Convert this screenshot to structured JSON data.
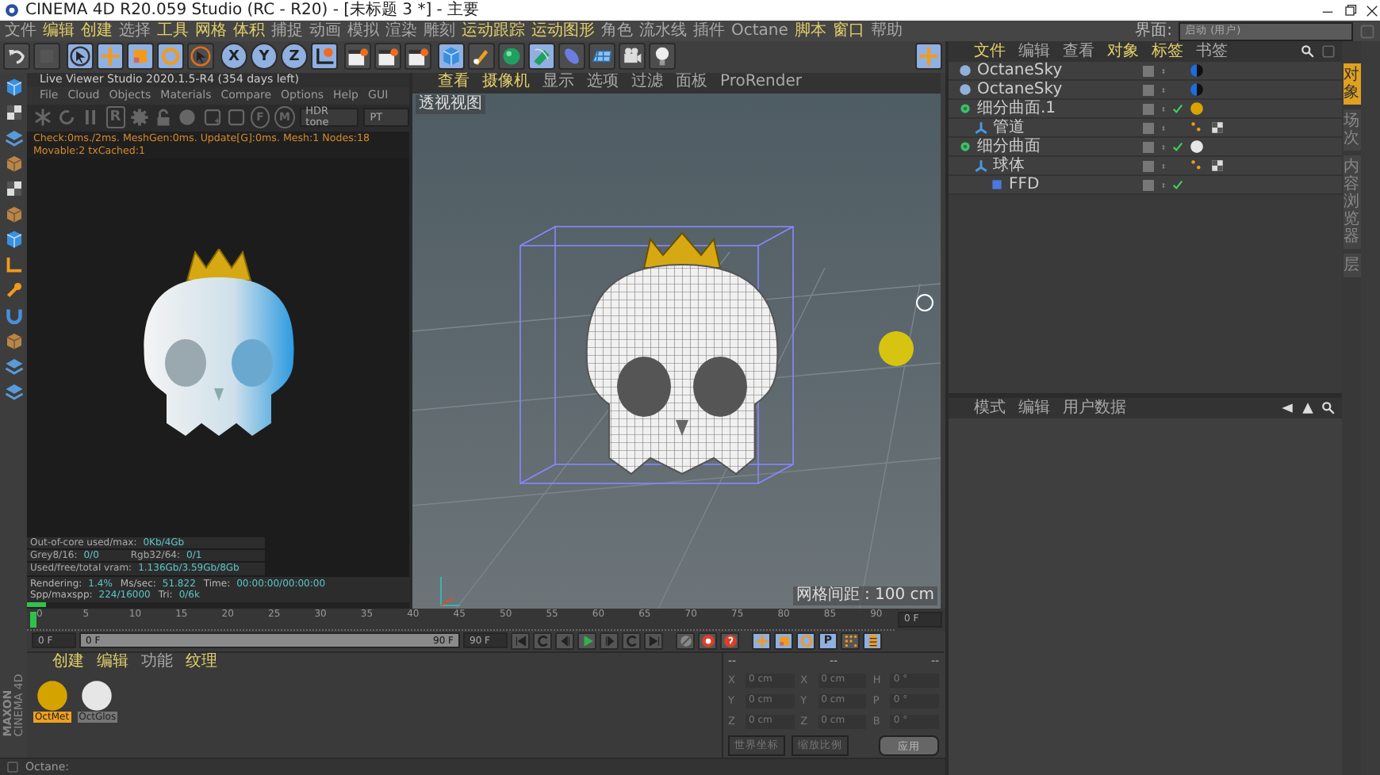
{
  "window": {
    "title": "CINEMA 4D R20.059 Studio (RC - R20) - [未标题 3 *] - 主要"
  },
  "menu_bar": [
    {
      "label": "文件",
      "accent": false
    },
    {
      "label": "编辑",
      "accent": true
    },
    {
      "label": "创建",
      "accent": true
    },
    {
      "label": "选择",
      "accent": false
    },
    {
      "label": "工具",
      "accent": true
    },
    {
      "label": "网格",
      "accent": true
    },
    {
      "label": "体积",
      "accent": true
    },
    {
      "label": "捕捉",
      "accent": false
    },
    {
      "label": "动画",
      "accent": false
    },
    {
      "label": "模拟",
      "accent": false
    },
    {
      "label": "渲染",
      "accent": false
    },
    {
      "label": "雕刻",
      "accent": false
    },
    {
      "label": "运动跟踪",
      "accent": true
    },
    {
      "label": "运动图形",
      "accent": true
    },
    {
      "label": "角色",
      "accent": false
    },
    {
      "label": "流水线",
      "accent": false
    },
    {
      "label": "插件",
      "accent": false
    },
    {
      "label": "Octane",
      "accent": false
    },
    {
      "label": "脚本",
      "accent": true
    },
    {
      "label": "窗口",
      "accent": true
    },
    {
      "label": "帮助",
      "accent": false
    }
  ],
  "layout": {
    "label": "界面:",
    "value": "启动 (用户)"
  },
  "toolbar": [
    {
      "kind": "undo",
      "active": false
    },
    {
      "kind": "redo",
      "active": false
    },
    {
      "kind": "select",
      "active": true
    },
    {
      "kind": "move",
      "active": true
    },
    {
      "kind": "scale",
      "active": true
    },
    {
      "kind": "rotate",
      "active": true
    },
    {
      "kind": "pointer",
      "active": false
    },
    {
      "kind": "axis",
      "label": "X",
      "active": true
    },
    {
      "kind": "axis",
      "label": "Y",
      "active": true
    },
    {
      "kind": "axis",
      "label": "Z",
      "active": true
    },
    {
      "kind": "coord",
      "active": true
    },
    {
      "kind": "clapper",
      "active": false
    },
    {
      "kind": "clapper",
      "active": false
    },
    {
      "kind": "clapper",
      "active": false
    },
    {
      "kind": "cube",
      "active": true
    },
    {
      "kind": "pen",
      "active": false
    },
    {
      "kind": "sphere",
      "active": false
    },
    {
      "kind": "spline",
      "active": true
    },
    {
      "kind": "capsule",
      "active": false
    },
    {
      "kind": "plane",
      "active": false
    },
    {
      "kind": "camera",
      "active": false
    },
    {
      "kind": "light",
      "active": false
    }
  ],
  "live_viewer": {
    "title": "Live Viewer Studio 2020.1.5-R4 (354 days left)",
    "menu": [
      "File",
      "Cloud",
      "Objects",
      "Materials",
      "Compare",
      "Options",
      "Help",
      "GUI"
    ],
    "tools": [
      {
        "kind": "asterisk"
      },
      {
        "kind": "refresh"
      },
      {
        "kind": "pause"
      },
      {
        "kind": "letter",
        "label": "R"
      },
      {
        "kind": "gear"
      },
      {
        "kind": "lock"
      },
      {
        "kind": "ball"
      },
      {
        "kind": "add"
      },
      {
        "kind": "square"
      },
      {
        "kind": "circle",
        "label": "F"
      },
      {
        "kind": "circle",
        "label": "M"
      }
    ],
    "dropdowns": [
      "HDR tone",
      "PT"
    ],
    "status": "Check:0ms./2ms. MeshGen:0ms. Update[G]:0ms. Mesh:1 Nodes:18 Movable:2 txCached:1",
    "stats": [
      {
        "label": "Out-of-core used/max:",
        "value": "0Kb/4Gb"
      },
      {
        "label": "Grey8/16:",
        "value": "0/0",
        "label_2": "Rgb32/64:",
        "value_2": "0/1"
      },
      {
        "label": "Used/free/total vram:",
        "value": "1.136Gb/3.59Gb/8Gb"
      }
    ],
    "render_stats": [
      {
        "label": "Rendering:",
        "value": "1.4%"
      },
      {
        "label": "Ms/sec:",
        "value": "51.822"
      },
      {
        "label": "Time:",
        "value": "00:00:00/00:00:00"
      },
      {
        "label": "Spp/maxspp:",
        "value": "224/16000"
      },
      {
        "label": "Tri:",
        "value": "0/6k"
      }
    ],
    "level": 0.05
  },
  "viewport": {
    "menu": [
      {
        "label": "查看",
        "accent": true
      },
      {
        "label": "摄像机",
        "accent": true
      },
      {
        "label": "显示",
        "accent": false
      },
      {
        "label": "选项",
        "accent": false
      },
      {
        "label": "过滤",
        "accent": false
      },
      {
        "label": "面板",
        "accent": false
      },
      {
        "label": "ProRender",
        "accent": false
      }
    ],
    "view_label": "透视视图",
    "grid_label": "网格间距 : 100 cm"
  },
  "timeline": {
    "level": 1,
    "ticks": [
      "0",
      "5",
      "10",
      "15",
      "20",
      "25",
      "30",
      "35",
      "40",
      "45",
      "50",
      "55",
      "60",
      "65",
      "70",
      "75",
      "80",
      "85",
      "90"
    ],
    "current_frame": "0 F",
    "start": "0 F",
    "range_start": "0 F",
    "range_end": "90 F",
    "end": "90 F"
  },
  "playback": [
    {
      "kind": "first",
      "active": false
    },
    {
      "kind": "loop",
      "active": false
    },
    {
      "kind": "prev",
      "active": false
    },
    {
      "kind": "play",
      "active": false
    },
    {
      "kind": "next",
      "active": false
    },
    {
      "kind": "loop",
      "active": false
    },
    {
      "kind": "last",
      "active": false
    },
    {
      "kind": "key",
      "active": false
    },
    {
      "kind": "record",
      "active": false
    },
    {
      "kind": "autokey",
      "active": false
    },
    {
      "kind": "move",
      "active": true
    },
    {
      "kind": "scale",
      "active": true
    },
    {
      "kind": "rotate",
      "active": true
    },
    {
      "kind": "param",
      "label": "P",
      "active": true
    },
    {
      "kind": "points",
      "active": false
    },
    {
      "kind": "film",
      "active": true
    }
  ],
  "materials": {
    "menu": [
      {
        "label": "创建",
        "accent": true
      },
      {
        "label": "编辑",
        "accent": true
      },
      {
        "label": "功能",
        "accent": false
      },
      {
        "label": "纹理",
        "accent": true
      }
    ],
    "items": [
      {
        "name": "OctMet",
        "color": "#d4a300",
        "selected": true
      },
      {
        "name": "OctGlos",
        "color": "#e6e6e6",
        "selected": false
      }
    ]
  },
  "coordinates": {
    "headers": [
      "--",
      "--",
      "--"
    ],
    "rows": [
      {
        "axis": "X",
        "position": "0 cm",
        "size_axis": "X",
        "size": "0 cm",
        "rot_axis": "H",
        "rotation": "0 °"
      },
      {
        "axis": "Y",
        "position": "0 cm",
        "size_axis": "Y",
        "size": "0 cm",
        "rot_axis": "P",
        "rotation": "0 °"
      },
      {
        "axis": "Z",
        "position": "0 cm",
        "size_axis": "Z",
        "size": "0 cm",
        "rot_axis": "B",
        "rotation": "0 °"
      }
    ],
    "dropdowns": [
      "世界坐标",
      "缩放比例"
    ],
    "apply": "应用"
  },
  "logo": {
    "brand": "MAXON",
    "product": "CINEMA 4D"
  },
  "status_bar": "Octane:",
  "object_manager": {
    "menu": [
      {
        "label": "文件",
        "accent": true
      },
      {
        "label": "编辑",
        "accent": false
      },
      {
        "label": "查看",
        "accent": false
      },
      {
        "label": "对象",
        "accent": true
      },
      {
        "label": "标签",
        "accent": true
      },
      {
        "label": "书签",
        "accent": false
      }
    ],
    "objects": [
      {
        "name": "OctaneSky",
        "kind": "sky",
        "checked": false,
        "tags": [
          {
            "kind": "environment"
          }
        ]
      },
      {
        "name": "OctaneSky",
        "kind": "sky",
        "checked": false,
        "tags": [
          {
            "kind": "environment"
          }
        ]
      },
      {
        "name": "细分曲面.1",
        "kind": "subdivision",
        "checked": true,
        "tags": [
          {
            "kind": "material",
            "color": "#d9a400"
          }
        ],
        "children": [
          {
            "name": "管道",
            "kind": "primitive",
            "checked": false,
            "tags": [
              {
                "kind": "phong"
              },
              {
                "kind": "uvw"
              }
            ]
          }
        ]
      },
      {
        "name": "细分曲面",
        "kind": "subdivision",
        "checked": true,
        "tags": [
          {
            "kind": "material",
            "color": "#e6e6e6"
          }
        ],
        "children": [
          {
            "name": "球体",
            "kind": "primitive",
            "checked": false,
            "tags": [
              {
                "kind": "phong"
              },
              {
                "kind": "uvw"
              }
            ],
            "children": [
              {
                "name": "FFD",
                "kind": "deformer",
                "checked": true
              }
            ]
          }
        ]
      }
    ]
  },
  "attribute_manager": {
    "menu": [
      "模式",
      "编辑",
      "用户数据"
    ]
  },
  "side_tabs": [
    {
      "label": "对象",
      "selected": true
    },
    {
      "label": "场次",
      "selected": false
    },
    {
      "label": "内容浏览器",
      "selected": false
    },
    {
      "label": "层",
      "selected": false
    }
  ]
}
